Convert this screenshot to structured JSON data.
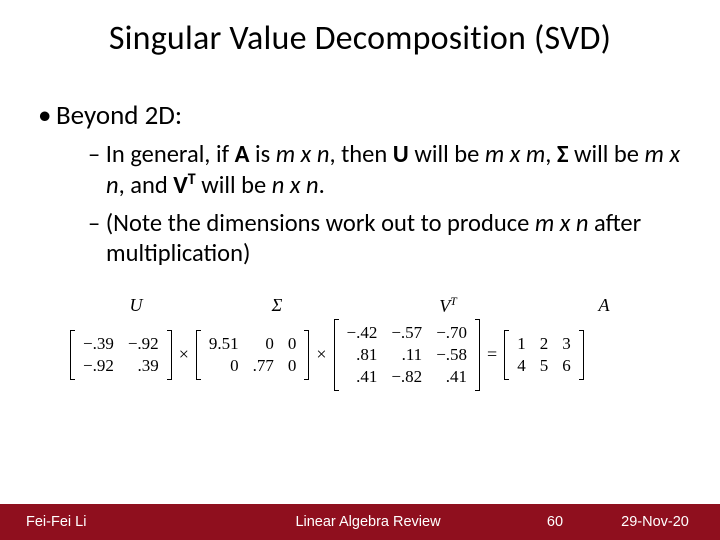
{
  "title": "Singular Value Decomposition (SVD)",
  "bullet1": "Beyond 2D:",
  "sub1_pre": "In general, if ",
  "sub1_A": "A",
  "sub1_t1": " is ",
  "sub1_mn": "m x n",
  "sub1_t2": ", then ",
  "sub1_U": "U",
  "sub1_t3": " will be ",
  "sub1_mm": "m x m",
  "sub1_t4": ", ",
  "sub1_S": "Σ",
  "sub1_t5": " will be ",
  "sub1_mn2": "m x n",
  "sub1_t6": ", and ",
  "sub1_V": "V",
  "sub1_T": "T",
  "sub1_t7": " will be ",
  "sub1_nn": "n x n",
  "sub1_t8": ".",
  "sub2_t1": "(Note the dimensions work out to produce ",
  "sub2_mn": "m x n",
  "sub2_t2": " after multiplication)",
  "eq": {
    "labels": {
      "U": "U",
      "S": "Σ",
      "V": "V",
      "T": "T",
      "A": "A"
    },
    "U": [
      [
        "−.39",
        "−.92"
      ],
      [
        "−.92",
        ".39"
      ]
    ],
    "S": [
      [
        "9.51",
        "0",
        "0"
      ],
      [
        "0",
        ".77",
        "0"
      ]
    ],
    "V": [
      [
        "−.42",
        "−.57",
        "−.70"
      ],
      [
        ".81",
        ".11",
        "−.58"
      ],
      [
        ".41",
        "−.82",
        ".41"
      ]
    ],
    "A": [
      [
        "1",
        "2",
        "3"
      ],
      [
        "4",
        "5",
        "6"
      ]
    ],
    "times": "×",
    "eqs": "="
  },
  "footer": {
    "author": "Fei-Fei Li",
    "title": "Linear Algebra Review",
    "page": "60",
    "date": "29-Nov-20"
  }
}
